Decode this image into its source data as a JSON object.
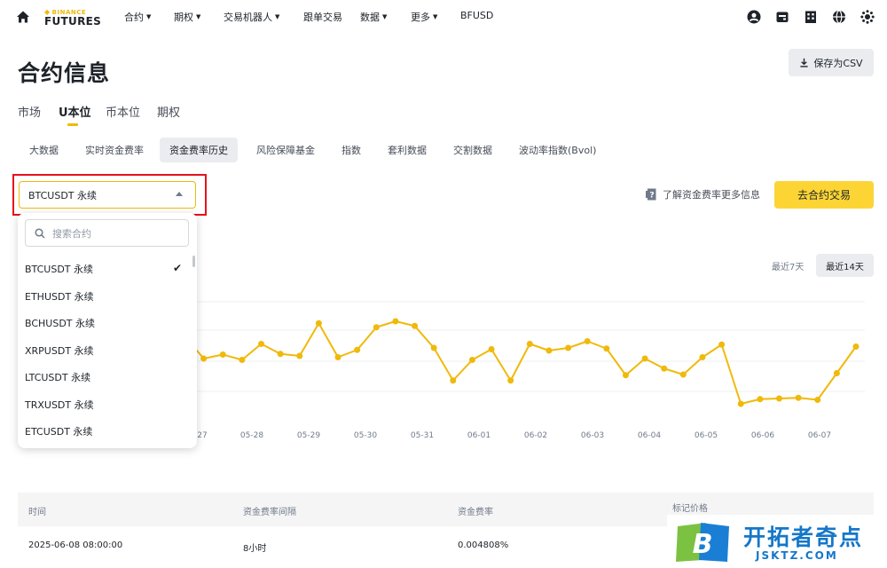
{
  "brand": {
    "logo_top": "BINANCE",
    "logo_bottom": "FUTURES"
  },
  "nav": {
    "items": [
      "合约",
      "期权",
      "交易机器人",
      "跟单交易",
      "数据",
      "更多",
      "BFUSD"
    ]
  },
  "header": {
    "title": "合约信息",
    "csv_button": "保存为CSV"
  },
  "tabs": [
    "市场",
    "U本位",
    "币本位",
    "期权"
  ],
  "active_tab": "U本位",
  "subtabs": [
    "大数据",
    "实时资金费率",
    "资金费率历史",
    "风险保障基金",
    "指数",
    "套利数据",
    "交割数据",
    "波动率指数(Bvol)"
  ],
  "active_subtab": "资金费率历史",
  "select": {
    "value": "BTCUSDT 永续"
  },
  "info_link": "了解资金费率更多信息",
  "trade_button": "去合约交易",
  "range": {
    "short": "最近7天",
    "long": "最近14天",
    "selected": "最近14天"
  },
  "dropdown": {
    "search_placeholder": "搜索合约",
    "items": [
      "BTCUSDT 永续",
      "ETHUSDT 永续",
      "BCHUSDT 永续",
      "XRPUSDT 永续",
      "LTCUSDT 永续",
      "TRXUSDT 永续",
      "ETCUSDT 永续"
    ],
    "selected": "BTCUSDT 永续"
  },
  "chart_data": {
    "type": "line",
    "x_tick_labels": [
      "27",
      "05-28",
      "05-29",
      "05-30",
      "05-31",
      "06-01",
      "06-02",
      "06-03",
      "06-04",
      "06-05",
      "06-06",
      "06-07"
    ],
    "values": [
      0.62,
      0.28,
      0.34,
      0.26,
      0.5,
      0.35,
      0.32,
      0.81,
      0.3,
      0.41,
      0.75,
      0.84,
      0.77,
      0.44,
      -0.05,
      0.26,
      0.42,
      -0.05,
      0.5,
      0.4,
      0.44,
      0.54,
      0.43,
      0.03,
      0.28,
      0.13,
      0.04,
      0.3,
      0.49,
      -0.4,
      -0.33,
      -0.32,
      -0.31,
      -0.34,
      0.06,
      0.46
    ],
    "line_color": "#f0b90b",
    "grid": true
  },
  "table": {
    "headers": [
      "时间",
      "资金费率间隔",
      "资金费率",
      "标记价格"
    ],
    "rows": [
      [
        "2025-06-08 08:00:00",
        "8小时",
        "0.004808%",
        ""
      ]
    ]
  },
  "watermark": {
    "title": "开拓者奇点",
    "subtitle": "JSKTZ.COM",
    "letter": "B"
  }
}
